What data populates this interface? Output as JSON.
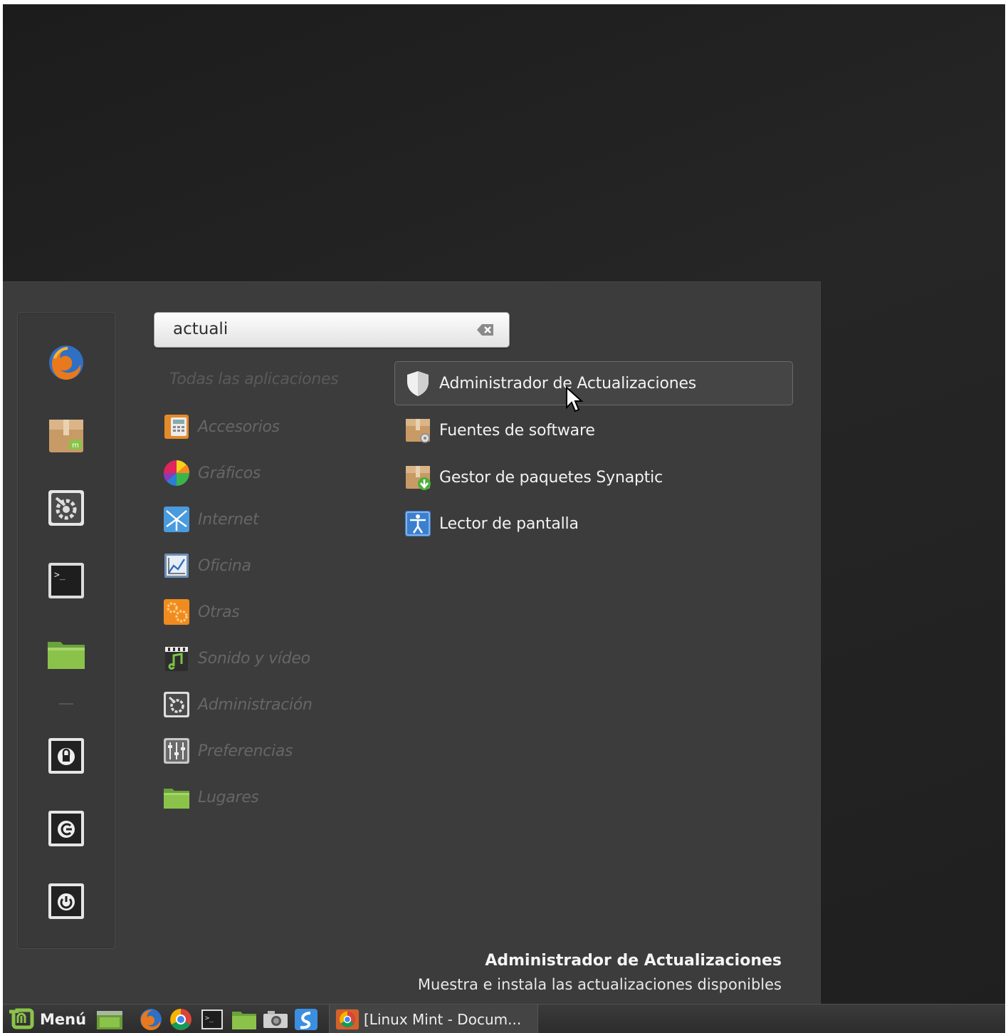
{
  "search": {
    "value": "actuali",
    "clear_icon": "clear-text-icon"
  },
  "favorites": [
    {
      "name": "firefox",
      "icon": "firefox-icon"
    },
    {
      "name": "software-manager",
      "icon": "package-icon"
    },
    {
      "name": "system-settings",
      "icon": "settings-icon"
    },
    {
      "name": "terminal",
      "icon": "terminal-icon"
    },
    {
      "name": "files",
      "icon": "folder-icon"
    },
    {
      "name": "lock-screen",
      "icon": "lock-icon"
    },
    {
      "name": "logout",
      "icon": "logout-icon"
    },
    {
      "name": "shutdown",
      "icon": "power-icon"
    }
  ],
  "categories": {
    "header": "Todas las aplicaciones",
    "items": [
      {
        "label": "Accesorios",
        "icon": "accessories-icon"
      },
      {
        "label": "Gráficos",
        "icon": "graphics-icon"
      },
      {
        "label": "Internet",
        "icon": "internet-icon"
      },
      {
        "label": "Oficina",
        "icon": "office-icon"
      },
      {
        "label": "Otras",
        "icon": "other-icon"
      },
      {
        "label": "Sonido y vídeo",
        "icon": "multimedia-icon"
      },
      {
        "label": "Administración",
        "icon": "administration-icon"
      },
      {
        "label": "Preferencias",
        "icon": "preferences-icon"
      },
      {
        "label": "Lugares",
        "icon": "places-icon"
      }
    ]
  },
  "results": [
    {
      "label": "Administrador de Actualizaciones",
      "icon": "shield-icon",
      "selected": true
    },
    {
      "label": "Fuentes de software",
      "icon": "software-sources-icon"
    },
    {
      "label": "Gestor de paquetes Synaptic",
      "icon": "synaptic-icon"
    },
    {
      "label": "Lector de pantalla",
      "icon": "accessibility-icon"
    }
  ],
  "description": {
    "title": "Administrador de Actualizaciones",
    "text": "Muestra e instala las actualizaciones disponibles"
  },
  "taskbar": {
    "menu_label": "Menú",
    "window_title": "[Linux Mint - Docum..."
  },
  "colors": {
    "panel": "#3c3c3c",
    "mint_green": "#8bc34a",
    "text": "#f2f2f2",
    "dim_text": "#666666"
  }
}
